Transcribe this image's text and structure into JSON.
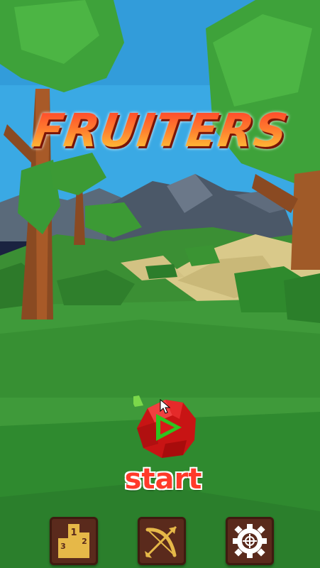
{
  "game": {
    "title": "FRUITERS",
    "start_label": "start"
  },
  "bottom_bar": {
    "buttons": [
      {
        "name": "leaderboard",
        "icon": "podium-icon",
        "podium_numbers": [
          "1",
          "2",
          "3"
        ]
      },
      {
        "name": "bow",
        "icon": "bow-arrow-icon"
      },
      {
        "name": "settings",
        "icon": "gear-icon"
      }
    ]
  },
  "colors": {
    "sky": "#3aa9e4",
    "grass": "#3f9a3a",
    "title_red": "#ff3b2a",
    "title_yellow": "#ffd93a",
    "apple_red": "#d81a1a",
    "play_green": "#2ec41f",
    "button_brown": "#5a2a1c",
    "icon_gold": "#e6b848"
  }
}
